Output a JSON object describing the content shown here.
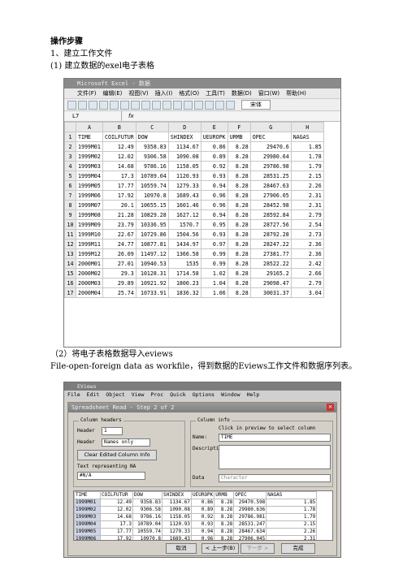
{
  "doc": {
    "heading": "操作步骤",
    "step1": "1、建立工作文件",
    "step1_sub": "(1) 建立数据的exel电子表格",
    "step2": "（2）将电子表格数据导入eviews",
    "step2_desc": "File-open-foreign data as workfile，得到数据的Eviews工作文件和数据序列表。"
  },
  "excel": {
    "title": "Microsoft Excel - 数据",
    "menu": [
      "文件(F)",
      "编辑(E)",
      "视图(V)",
      "插入(I)",
      "格式(O)",
      "工具(T)",
      "数据(D)",
      "窗口(W)",
      "帮助(H)"
    ],
    "font": "宋体",
    "namebox": "L7",
    "fx": "fx",
    "cols": [
      "A",
      "B",
      "C",
      "D",
      "E",
      "F",
      "G",
      "H"
    ],
    "rows": [
      [
        "1",
        "TIME",
        "COILFUTUR",
        "DOW",
        "SHINDEX",
        "UEUROPK",
        "URMB",
        "OPEC",
        "NAGAS"
      ],
      [
        "2",
        "1999M01",
        "12.49",
        "9358.83",
        "1134.67",
        "0.86",
        "8.28",
        "29470.6",
        "1.85"
      ],
      [
        "3",
        "1999M02",
        "12.02",
        "9306.58",
        "1090.08",
        "0.89",
        "8.28",
        "29980.64",
        "1.78"
      ],
      [
        "4",
        "1999M03",
        "14.68",
        "9786.16",
        "1158.05",
        "0.92",
        "8.28",
        "29786.98",
        "1.79"
      ],
      [
        "5",
        "1999M04",
        "17.3",
        "10789.04",
        "1120.93",
        "0.93",
        "8.28",
        "28531.25",
        "2.15"
      ],
      [
        "6",
        "1999M05",
        "17.77",
        "10559.74",
        "1279.33",
        "0.94",
        "8.28",
        "28467.63",
        "2.26"
      ],
      [
        "7",
        "1999M06",
        "17.92",
        "10970.8",
        "1689.43",
        "0.96",
        "8.28",
        "27906.05",
        "2.31"
      ],
      [
        "8",
        "1999M07",
        "20.1",
        "10655.15",
        "1601.46",
        "0.96",
        "8.28",
        "28452.98",
        "2.31"
      ],
      [
        "9",
        "1999M08",
        "21.28",
        "10829.28",
        "1627.12",
        "0.94",
        "8.28",
        "28592.84",
        "2.79"
      ],
      [
        "10",
        "1999M09",
        "23.79",
        "10336.95",
        "1570.7",
        "0.95",
        "8.28",
        "28727.56",
        "2.54"
      ],
      [
        "11",
        "1999M10",
        "22.67",
        "10729.86",
        "1504.56",
        "0.93",
        "8.28",
        "28792.28",
        "2.73"
      ],
      [
        "12",
        "1999M11",
        "24.77",
        "10877.81",
        "1434.97",
        "0.97",
        "8.28",
        "28247.22",
        "2.36"
      ],
      [
        "13",
        "1999M12",
        "26.09",
        "11497.12",
        "1366.58",
        "0.99",
        "8.28",
        "27381.77",
        "2.36"
      ],
      [
        "14",
        "2000M01",
        "27.01",
        "10940.53",
        "1535",
        "0.99",
        "8.28",
        "28522.22",
        "2.42"
      ],
      [
        "15",
        "2000M02",
        "29.3",
        "10128.31",
        "1714.58",
        "1.02",
        "8.28",
        "29165.2",
        "2.66"
      ],
      [
        "16",
        "2000M03",
        "29.89",
        "10921.92",
        "1800.23",
        "1.04",
        "8.28",
        "29098.47",
        "2.79"
      ],
      [
        "17",
        "2000M04",
        "25.74",
        "10733.91",
        "1836.32",
        "1.06",
        "8.28",
        "30031.37",
        "3.04"
      ]
    ]
  },
  "eviews": {
    "title": "EViews",
    "menu": [
      "File",
      "Edit",
      "Object",
      "View",
      "Proc",
      "Quick",
      "Options",
      "Window",
      "Help"
    ],
    "dialog_title": "Spreadsheet Read - Step 2 of 2",
    "column_headers_label": "Column headers",
    "header_label": "Header",
    "header_value": "1",
    "header_type_label": "Header",
    "header_type_value": "Names only",
    "clear_button": "Clear Edited Column Info",
    "na_label": "Text representing NA",
    "na_value": "#N/A",
    "column_info_label": "Column info",
    "click_hint": "Click in preview to select column",
    "name_label": "Name:",
    "name_value": "TIME",
    "description_label": "Description:",
    "data_label": "Data",
    "data_value": "Character",
    "preview_header": [
      "TIME",
      "COILFUTUR",
      "DOW",
      "SHINDEX",
      "UEUROPK",
      "URMB",
      "OPEC",
      "NAGAS"
    ],
    "preview_rows": [
      [
        "1999M01",
        "12.49",
        "9358.83",
        "1134.67",
        "0.86",
        "8.28",
        "29470.598",
        "1.85"
      ],
      [
        "1999M02",
        "12.02",
        "9306.58",
        "1090.08",
        "0.89",
        "8.28",
        "29980.636",
        "1.78"
      ],
      [
        "1999M03",
        "14.68",
        "9786.16",
        "1158.05",
        "0.92",
        "8.28",
        "29786.981",
        "1.79"
      ],
      [
        "1999M04",
        "17.3",
        "10789.04",
        "1120.93",
        "0.93",
        "8.28",
        "28531.247",
        "2.15"
      ],
      [
        "1999M05",
        "17.77",
        "10559.74",
        "1279.33",
        "0.94",
        "8.28",
        "28467.634",
        "2.26"
      ],
      [
        "1999M06",
        "17.92",
        "10970.8",
        "1689.43",
        "0.96",
        "8.28",
        "27906.045",
        "2.31"
      ],
      [
        "1999M07",
        "20.1",
        "10655.15",
        "1601.46",
        "0.96",
        "8.28",
        "28452.981",
        "2.31"
      ],
      [
        "1999M08",
        "21.28",
        "10829.28",
        "1627.12",
        "0.94",
        "8.28",
        "28592.838",
        "2.79"
      ]
    ],
    "cancel": "取消",
    "back": "< 上一步(B)",
    "next": "下一步 >",
    "finish": "完成"
  }
}
